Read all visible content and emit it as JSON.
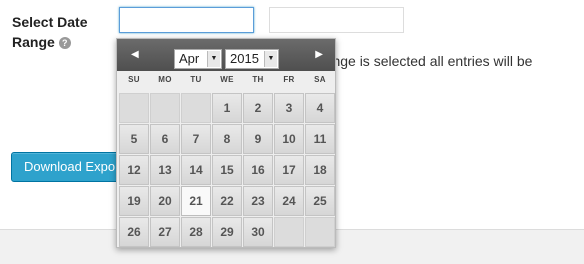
{
  "form": {
    "label_line1": "Select Date",
    "label_line2": "Range",
    "help_icon_glyph": "?",
    "start_date_value": "",
    "end_date_value": "",
    "note_text": "range is selected all entries will be",
    "download_button_label": "Download Expo"
  },
  "calendar": {
    "prev_glyph": "◀",
    "next_glyph": "▶",
    "month": "Apr",
    "year": "2015",
    "dropdown_arrow": "▼",
    "weekdays": [
      "SU",
      "MO",
      "TU",
      "WE",
      "TH",
      "FR",
      "SA"
    ],
    "weeks": [
      [
        "",
        "",
        "",
        "1",
        "2",
        "3",
        "4"
      ],
      [
        "5",
        "6",
        "7",
        "8",
        "9",
        "10",
        "11"
      ],
      [
        "12",
        "13",
        "14",
        "15",
        "16",
        "17",
        "18"
      ],
      [
        "19",
        "20",
        "21",
        "22",
        "23",
        "24",
        "25"
      ],
      [
        "26",
        "27",
        "28",
        "29",
        "30",
        "",
        ""
      ]
    ],
    "today": "21"
  },
  "colors": {
    "accent": "#2ea2cc",
    "header_bg": "#555555"
  }
}
